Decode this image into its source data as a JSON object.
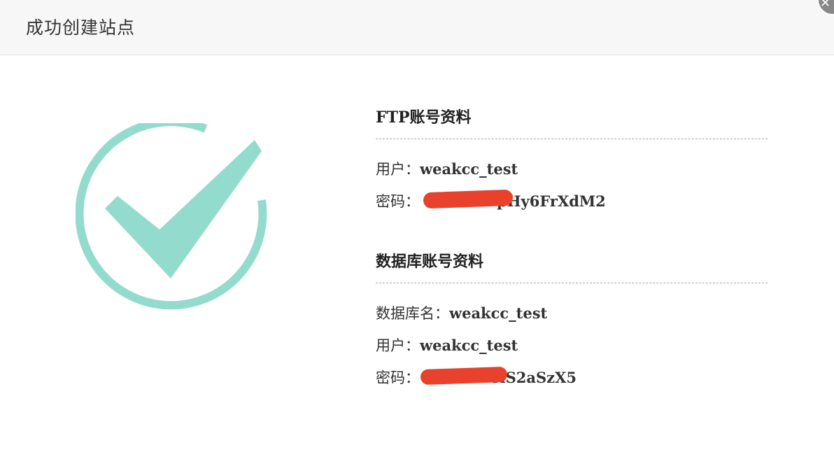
{
  "dialog": {
    "title": "成功创建站点"
  },
  "ftp": {
    "heading": "FTP账号资料",
    "user_label": "用户：",
    "user_value": "weakcc_test",
    "password_label": "密码：",
    "password_value_visible": "pHy6FrXdM2"
  },
  "database": {
    "heading": "数据库账号资料",
    "dbname_label": "数据库名：",
    "dbname_value": "weakcc_test",
    "user_label": "用户：",
    "user_value": "weakcc_test",
    "password_label": "密码：",
    "password_value_visible": "8iS2aSzX5"
  },
  "icons": {
    "success": "check-circle-icon",
    "close": "close-icon"
  },
  "colors": {
    "check": "#93dccd",
    "redaction": "#e8412c",
    "header_bg": "#f7f7f7"
  }
}
